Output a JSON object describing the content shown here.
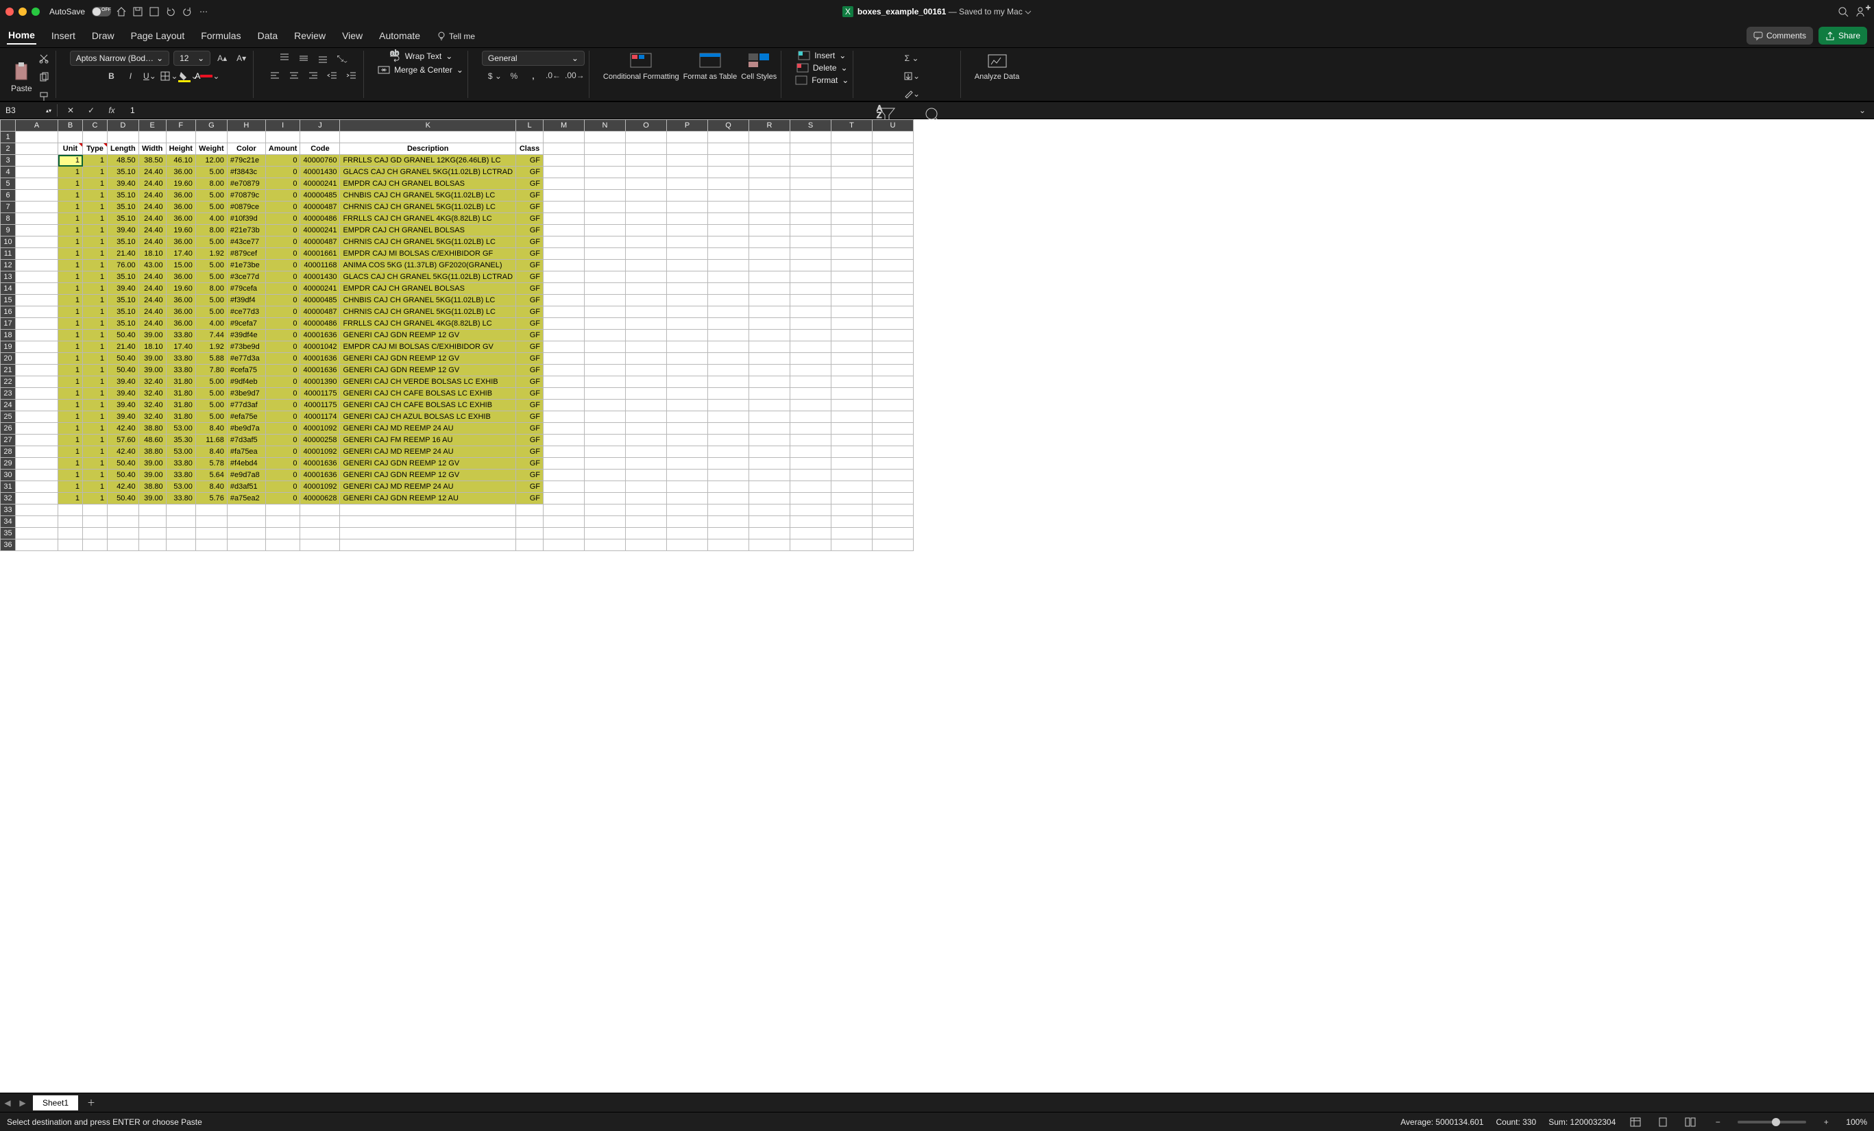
{
  "topbar": {
    "autosave": "AutoSave",
    "title_file": "boxes_example_00161",
    "title_suffix": " — Saved to my Mac"
  },
  "tabs": [
    "Home",
    "Insert",
    "Draw",
    "Page Layout",
    "Formulas",
    "Data",
    "Review",
    "View",
    "Automate",
    "Tell me"
  ],
  "comments": "Comments",
  "share": "Share",
  "ribbon": {
    "paste": "Paste",
    "font": "Aptos Narrow (Bod…",
    "size": "12",
    "wrap": "Wrap Text",
    "merge": "Merge & Center",
    "numfmt": "General",
    "cond": "Conditional Formatting",
    "fmttbl": "Format as Table",
    "cellst": "Cell Styles",
    "insert": "Insert",
    "delete": "Delete",
    "format": "Format",
    "sort": "Sort & Filter",
    "find": "Find & Select",
    "analyze": "Analyze Data"
  },
  "formula": {
    "name": "B3",
    "value": "1"
  },
  "columns": [
    "A",
    "B",
    "C",
    "D",
    "E",
    "F",
    "G",
    "H",
    "I",
    "J",
    "K",
    "L",
    "M",
    "N",
    "O",
    "P",
    "Q",
    "R",
    "S",
    "T",
    "U"
  ],
  "headers": [
    "Unit",
    "Type",
    "Length",
    "Width",
    "Height",
    "Weight",
    "Color",
    "Amount",
    "Code",
    "Description",
    "Class"
  ],
  "rows": [
    {
      "u": 1,
      "t": 1,
      "l": "48.50",
      "w": "38.50",
      "h": "46.10",
      "wt": "12.00",
      "c": "#79c21e",
      "a": 0,
      "cd": "40000760",
      "d": "FRRLLS CAJ GD GRANEL 12KG(26.46LB) LC",
      "cl": "GF"
    },
    {
      "u": 1,
      "t": 1,
      "l": "35.10",
      "w": "24.40",
      "h": "36.00",
      "wt": "5.00",
      "c": "#f3843c",
      "a": 0,
      "cd": "40001430",
      "d": "GLACS CAJ CH GRANEL 5KG(11.02LB) LCTRAD",
      "cl": "GF"
    },
    {
      "u": 1,
      "t": 1,
      "l": "39.40",
      "w": "24.40",
      "h": "19.60",
      "wt": "8.00",
      "c": "#e70879",
      "a": 0,
      "cd": "40000241",
      "d": "EMPDR CAJ CH GRANEL BOLSAS",
      "cl": "GF"
    },
    {
      "u": 1,
      "t": 1,
      "l": "35.10",
      "w": "24.40",
      "h": "36.00",
      "wt": "5.00",
      "c": "#70879c",
      "a": 0,
      "cd": "40000485",
      "d": "CHNBIS CAJ CH GRANEL 5KG(11.02LB) LC",
      "cl": "GF"
    },
    {
      "u": 1,
      "t": 1,
      "l": "35.10",
      "w": "24.40",
      "h": "36.00",
      "wt": "5.00",
      "c": "#0879ce",
      "a": 0,
      "cd": "40000487",
      "d": "CHRNIS CAJ CH GRANEL 5KG(11.02LB) LC",
      "cl": "GF"
    },
    {
      "u": 1,
      "t": 1,
      "l": "35.10",
      "w": "24.40",
      "h": "36.00",
      "wt": "4.00",
      "c": "#10f39d",
      "a": 0,
      "cd": "40000486",
      "d": "FRRLLS CAJ CH GRANEL 4KG(8.82LB) LC",
      "cl": "GF"
    },
    {
      "u": 1,
      "t": 1,
      "l": "39.40",
      "w": "24.40",
      "h": "19.60",
      "wt": "8.00",
      "c": "#21e73b",
      "a": 0,
      "cd": "40000241",
      "d": "EMPDR CAJ CH GRANEL BOLSAS",
      "cl": "GF"
    },
    {
      "u": 1,
      "t": 1,
      "l": "35.10",
      "w": "24.40",
      "h": "36.00",
      "wt": "5.00",
      "c": "#43ce77",
      "a": 0,
      "cd": "40000487",
      "d": "CHRNIS CAJ CH GRANEL 5KG(11.02LB) LC",
      "cl": "GF"
    },
    {
      "u": 1,
      "t": 1,
      "l": "21.40",
      "w": "18.10",
      "h": "17.40",
      "wt": "1.92",
      "c": "#879cef",
      "a": 0,
      "cd": "40001661",
      "d": "EMPDR CAJ MI BOLSAS C/EXHIBIDOR GF",
      "cl": "GF"
    },
    {
      "u": 1,
      "t": 1,
      "l": "76.00",
      "w": "43.00",
      "h": "15.00",
      "wt": "5.00",
      "c": "#1e73be",
      "a": 0,
      "cd": "40001168",
      "d": "ANIMA COS 5KG (11.37LB) GF2020(GRANEL)",
      "cl": "GF"
    },
    {
      "u": 1,
      "t": 1,
      "l": "35.10",
      "w": "24.40",
      "h": "36.00",
      "wt": "5.00",
      "c": "#3ce77d",
      "a": 0,
      "cd": "40001430",
      "d": "GLACS CAJ CH GRANEL 5KG(11.02LB) LCTRAD",
      "cl": "GF"
    },
    {
      "u": 1,
      "t": 1,
      "l": "39.40",
      "w": "24.40",
      "h": "19.60",
      "wt": "8.00",
      "c": "#79cefa",
      "a": 0,
      "cd": "40000241",
      "d": "EMPDR CAJ CH GRANEL BOLSAS",
      "cl": "GF"
    },
    {
      "u": 1,
      "t": 1,
      "l": "35.10",
      "w": "24.40",
      "h": "36.00",
      "wt": "5.00",
      "c": "#f39df4",
      "a": 0,
      "cd": "40000485",
      "d": "CHNBIS CAJ CH GRANEL 5KG(11.02LB) LC",
      "cl": "GF"
    },
    {
      "u": 1,
      "t": 1,
      "l": "35.10",
      "w": "24.40",
      "h": "36.00",
      "wt": "5.00",
      "c": "#ce77d3",
      "a": 0,
      "cd": "40000487",
      "d": "CHRNIS CAJ CH GRANEL 5KG(11.02LB) LC",
      "cl": "GF"
    },
    {
      "u": 1,
      "t": 1,
      "l": "35.10",
      "w": "24.40",
      "h": "36.00",
      "wt": "4.00",
      "c": "#9cefa7",
      "a": 0,
      "cd": "40000486",
      "d": "FRRLLS CAJ CH GRANEL 4KG(8.82LB) LC",
      "cl": "GF"
    },
    {
      "u": 1,
      "t": 1,
      "l": "50.40",
      "w": "39.00",
      "h": "33.80",
      "wt": "7.44",
      "c": "#39df4e",
      "a": 0,
      "cd": "40001636",
      "d": "GENERI CAJ GDN REEMP 12 GV",
      "cl": "GF"
    },
    {
      "u": 1,
      "t": 1,
      "l": "21.40",
      "w": "18.10",
      "h": "17.40",
      "wt": "1.92",
      "c": "#73be9d",
      "a": 0,
      "cd": "40001042",
      "d": "EMPDR CAJ MI BOLSAS C/EXHIBIDOR GV",
      "cl": "GF"
    },
    {
      "u": 1,
      "t": 1,
      "l": "50.40",
      "w": "39.00",
      "h": "33.80",
      "wt": "5.88",
      "c": "#e77d3a",
      "a": 0,
      "cd": "40001636",
      "d": "GENERI CAJ GDN REEMP 12 GV",
      "cl": "GF"
    },
    {
      "u": 1,
      "t": 1,
      "l": "50.40",
      "w": "39.00",
      "h": "33.80",
      "wt": "7.80",
      "c": "#cefa75",
      "a": 0,
      "cd": "40001636",
      "d": "GENERI CAJ GDN REEMP 12 GV",
      "cl": "GF"
    },
    {
      "u": 1,
      "t": 1,
      "l": "39.40",
      "w": "32.40",
      "h": "31.80",
      "wt": "5.00",
      "c": "#9df4eb",
      "a": 0,
      "cd": "40001390",
      "d": "GENERI CAJ CH VERDE BOLSAS LC EXHIB",
      "cl": "GF"
    },
    {
      "u": 1,
      "t": 1,
      "l": "39.40",
      "w": "32.40",
      "h": "31.80",
      "wt": "5.00",
      "c": "#3be9d7",
      "a": 0,
      "cd": "40001175",
      "d": "GENERI CAJ CH CAFE BOLSAS LC EXHIB",
      "cl": "GF"
    },
    {
      "u": 1,
      "t": 1,
      "l": "39.40",
      "w": "32.40",
      "h": "31.80",
      "wt": "5.00",
      "c": "#77d3af",
      "a": 0,
      "cd": "40001175",
      "d": "GENERI CAJ CH CAFE BOLSAS LC EXHIB",
      "cl": "GF"
    },
    {
      "u": 1,
      "t": 1,
      "l": "39.40",
      "w": "32.40",
      "h": "31.80",
      "wt": "5.00",
      "c": "#efa75e",
      "a": 0,
      "cd": "40001174",
      "d": "GENERI CAJ CH AZUL BOLSAS LC EXHIB",
      "cl": "GF"
    },
    {
      "u": 1,
      "t": 1,
      "l": "42.40",
      "w": "38.80",
      "h": "53.00",
      "wt": "8.40",
      "c": "#be9d7a",
      "a": 0,
      "cd": "40001092",
      "d": "GENERI CAJ MD REEMP 24 AU",
      "cl": "GF"
    },
    {
      "u": 1,
      "t": 1,
      "l": "57.60",
      "w": "48.60",
      "h": "35.30",
      "wt": "11.68",
      "c": "#7d3af5",
      "a": 0,
      "cd": "40000258",
      "d": "GENERI CAJ FM REEMP 16 AU",
      "cl": "GF"
    },
    {
      "u": 1,
      "t": 1,
      "l": "42.40",
      "w": "38.80",
      "h": "53.00",
      "wt": "8.40",
      "c": "#fa75ea",
      "a": 0,
      "cd": "40001092",
      "d": "GENERI CAJ MD REEMP 24 AU",
      "cl": "GF"
    },
    {
      "u": 1,
      "t": 1,
      "l": "50.40",
      "w": "39.00",
      "h": "33.80",
      "wt": "5.78",
      "c": "#f4ebd4",
      "a": 0,
      "cd": "40001636",
      "d": "GENERI CAJ GDN REEMP 12 GV",
      "cl": "GF"
    },
    {
      "u": 1,
      "t": 1,
      "l": "50.40",
      "w": "39.00",
      "h": "33.80",
      "wt": "5.64",
      "c": "#e9d7a8",
      "a": 0,
      "cd": "40001636",
      "d": "GENERI CAJ GDN REEMP 12 GV",
      "cl": "GF"
    },
    {
      "u": 1,
      "t": 1,
      "l": "42.40",
      "w": "38.80",
      "h": "53.00",
      "wt": "8.40",
      "c": "#d3af51",
      "a": 0,
      "cd": "40001092",
      "d": "GENERI CAJ MD REEMP 24 AU",
      "cl": "GF"
    },
    {
      "u": 1,
      "t": 1,
      "l": "50.40",
      "w": "39.00",
      "h": "33.80",
      "wt": "5.76",
      "c": "#a75ea2",
      "a": 0,
      "cd": "40000628",
      "d": "GENERI CAJ GDN REEMP 12 AU",
      "cl": "GF"
    }
  ],
  "sheet": "Sheet1",
  "status": {
    "msg": "Select destination and press ENTER or choose Paste",
    "avg": "Average: 5000134.601",
    "cnt": "Count: 330",
    "sum": "Sum: 1200032304",
    "zoom": "100%"
  }
}
